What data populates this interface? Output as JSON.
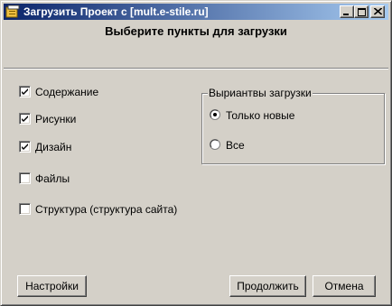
{
  "window": {
    "title": "Загрузить Проект с [mult.e-stile.ru]",
    "icon": "app-icon",
    "controls": [
      "minimize-icon",
      "maximize-icon",
      "close-icon"
    ]
  },
  "header": {
    "title": "Выберите пункты для загрузки"
  },
  "checkboxes": [
    {
      "label": "Содержание",
      "checked": true
    },
    {
      "label": "Рисунки",
      "checked": true
    },
    {
      "label": "Дизайн",
      "checked": true
    },
    {
      "label": "Файлы",
      "checked": false
    },
    {
      "label": "Структура  (структура сайта)",
      "checked": false
    }
  ],
  "load_options": {
    "legend": "Выриантвы загрузки",
    "options": [
      {
        "label": "Только новые",
        "selected": true
      },
      {
        "label": "Все",
        "selected": false
      }
    ]
  },
  "buttons": {
    "settings": "Настройки",
    "continue": "Продолжить",
    "cancel": "Отмена"
  },
  "colors": {
    "titlebar_start": "#0a246a",
    "titlebar_end": "#a6caf0",
    "face": "#d4d0c8"
  }
}
